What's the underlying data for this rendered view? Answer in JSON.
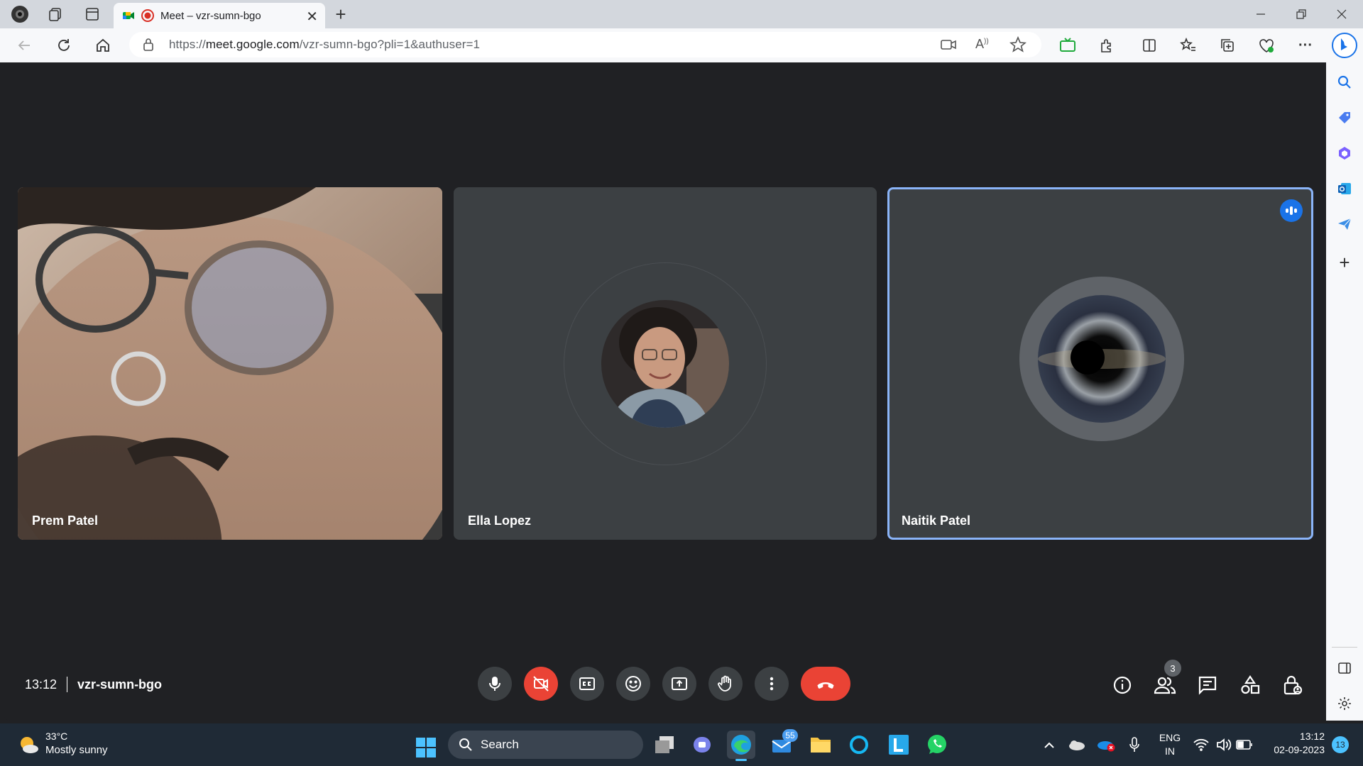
{
  "browser": {
    "tab_title": "Meet – vzr-sumn-bgo",
    "url_prefix": "https://",
    "url_domain": "meet.google.com",
    "url_path": "/vzr-sumn-bgo?pli=1&authuser=1"
  },
  "meet": {
    "participants": [
      {
        "name": "Prem Patel",
        "video": "on"
      },
      {
        "name": "Ella Lopez",
        "video": "off"
      },
      {
        "name": "Naitik Patel",
        "video": "off",
        "speaking": true
      }
    ],
    "time": "13:12",
    "meeting_code": "vzr-sumn-bgo",
    "people_count": "3",
    "accent": "#8ab4f8",
    "end_call_color": "#ea4335"
  },
  "taskbar": {
    "weather_temp": "33°C",
    "weather_desc": "Mostly sunny",
    "search_label": "Search",
    "mail_badge": "55",
    "lang_line1": "ENG",
    "lang_line2": "IN",
    "clock_time": "13:12",
    "clock_date": "02-09-2023",
    "notif_count": "13"
  }
}
